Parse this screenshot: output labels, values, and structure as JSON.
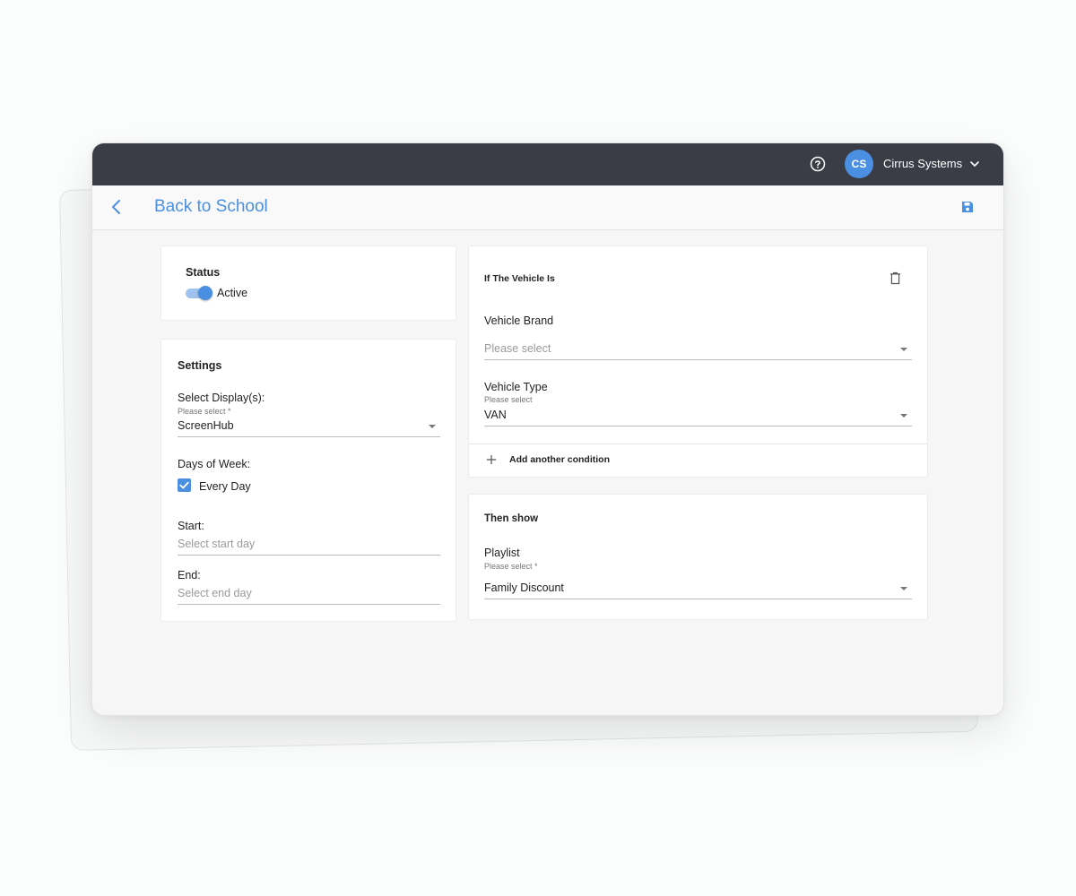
{
  "topbar": {
    "help_icon": "help-circle-icon",
    "avatar_initials": "CS",
    "account_name": "Cirrus Systems",
    "account_menu_icon": "chevron-down-icon"
  },
  "header": {
    "back_icon": "chevron-left-icon",
    "title": "Back to School",
    "save_icon": "save-icon"
  },
  "status_card": {
    "title": "Status",
    "toggle_label": "Active",
    "toggle_on": true
  },
  "settings_card": {
    "title": "Settings",
    "display_label": "Select Display(s):",
    "display_hint": "Please select *",
    "display_value": "ScreenHub",
    "days_label": "Days of Week:",
    "every_day_label": "Every Day",
    "every_day_checked": true,
    "start_label": "Start:",
    "start_placeholder": "Select start day",
    "end_label": "End:",
    "end_placeholder": "Select end day"
  },
  "condition_card": {
    "title": "If The Vehicle Is",
    "delete_icon": "trash-icon",
    "brand_label": "Vehicle Brand",
    "brand_placeholder": "Please select",
    "type_label": "Vehicle Type",
    "type_hint": "Please select",
    "type_value": "VAN",
    "add_condition_label": "Add another condition",
    "add_icon": "plus-icon"
  },
  "then_card": {
    "title": "Then show",
    "playlist_label": "Playlist",
    "playlist_hint": "Please select *",
    "playlist_value": "Family Discount"
  },
  "colors": {
    "accent": "#4a8fe2",
    "topbar": "#3a3d46"
  }
}
